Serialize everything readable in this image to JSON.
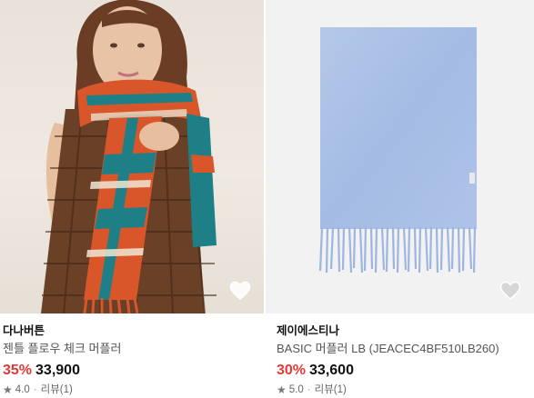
{
  "products": [
    {
      "brand": "다나버튼",
      "name": "젠틀 플로우 체크 머플러",
      "discount": "35%",
      "price": "33,900",
      "rating": "4.0",
      "reviews": "리뷰(1)",
      "wish_icon": "heart-outline-icon"
    },
    {
      "brand": "제이에스티나",
      "name": "BASIC 머플러 LB (JEACEC4BF510LB260)",
      "discount": "30%",
      "price": "33,600",
      "rating": "5.0",
      "reviews": "리뷰(1)",
      "wish_icon": "heart-outline-icon"
    }
  ],
  "colors": {
    "discount": "#e53935",
    "scarf_blue": "#a9c0e6",
    "plaid_orange": "#d8562a",
    "plaid_teal": "#1f7f86"
  }
}
